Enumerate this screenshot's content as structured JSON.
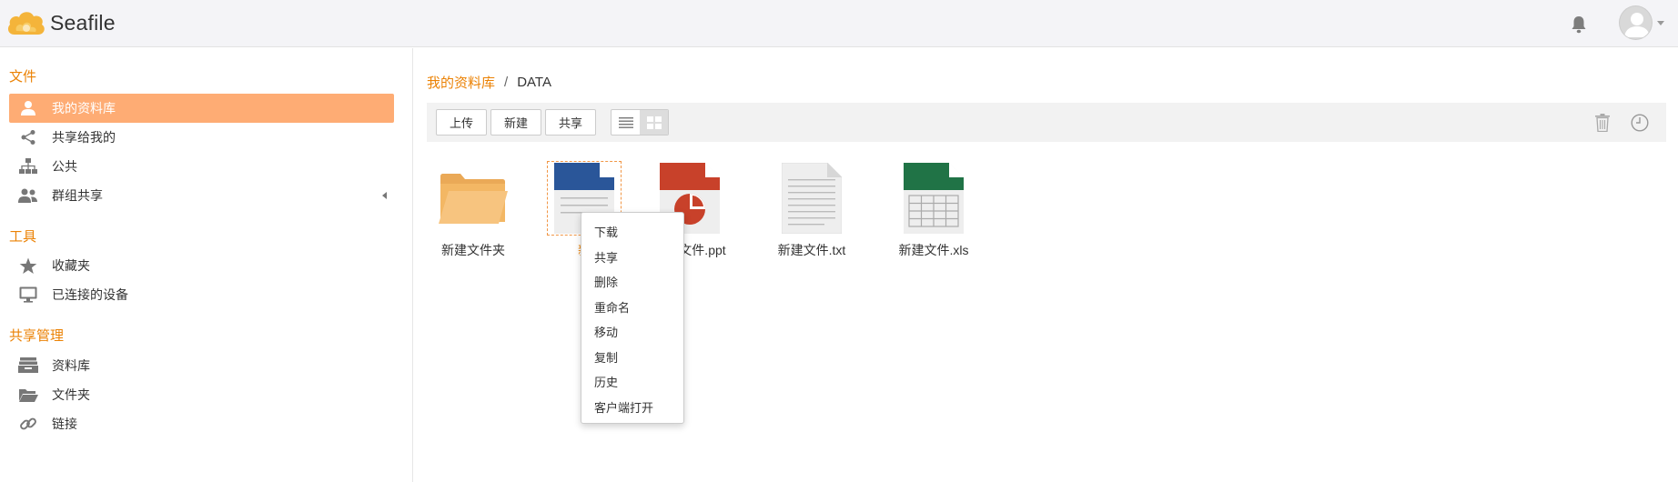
{
  "header": {
    "app_name": "Seafile",
    "logo_color": "#f4a62a",
    "bell_icon": "bell-icon",
    "avatar_icon": "user-avatar-icon"
  },
  "sidebar": {
    "sections": [
      {
        "heading": "文件",
        "items": [
          {
            "label": "我的资料库",
            "icon": "user-icon",
            "active": true
          },
          {
            "label": "共享给我的",
            "icon": "share-icon",
            "active": false
          },
          {
            "label": "公共",
            "icon": "sitemap-icon",
            "active": false
          },
          {
            "label": "群组共享",
            "icon": "group-icon",
            "active": false
          }
        ]
      },
      {
        "heading": "工具",
        "items": [
          {
            "label": "收藏夹",
            "icon": "star-icon",
            "active": false
          },
          {
            "label": "已连接的设备",
            "icon": "monitor-icon",
            "active": false
          }
        ]
      },
      {
        "heading": "共享管理",
        "items": [
          {
            "label": "资料库",
            "icon": "library-icon",
            "active": false
          },
          {
            "label": "文件夹",
            "icon": "folder-icon",
            "active": false
          },
          {
            "label": "链接",
            "icon": "link-icon",
            "active": false
          }
        ]
      }
    ],
    "accent_color": "#eb8205",
    "active_bg": "#feac74"
  },
  "breadcrumb": {
    "root": "我的资料库",
    "separator": "/",
    "current": "DATA"
  },
  "toolbar": {
    "upload": "上传",
    "new": "新建",
    "share": "共享",
    "view_list_icon": "list-view-icon",
    "view_grid_icon": "grid-view-icon",
    "trash_icon": "trash-icon",
    "history_icon": "clock-icon"
  },
  "files": [
    {
      "name": "新建文件夹",
      "type": "folder"
    },
    {
      "name": "新建文件.docx",
      "visible_name": "新",
      "type": "docx",
      "selected": true
    },
    {
      "name": "新建文件.ppt",
      "type": "ppt"
    },
    {
      "name": "新建文件.txt",
      "type": "txt"
    },
    {
      "name": "新建文件.xls",
      "type": "xls"
    }
  ],
  "context_menu": {
    "items": [
      "下载",
      "共享",
      "删除",
      "重命名",
      "移动",
      "复制",
      "历史",
      "客户端打开"
    ]
  }
}
